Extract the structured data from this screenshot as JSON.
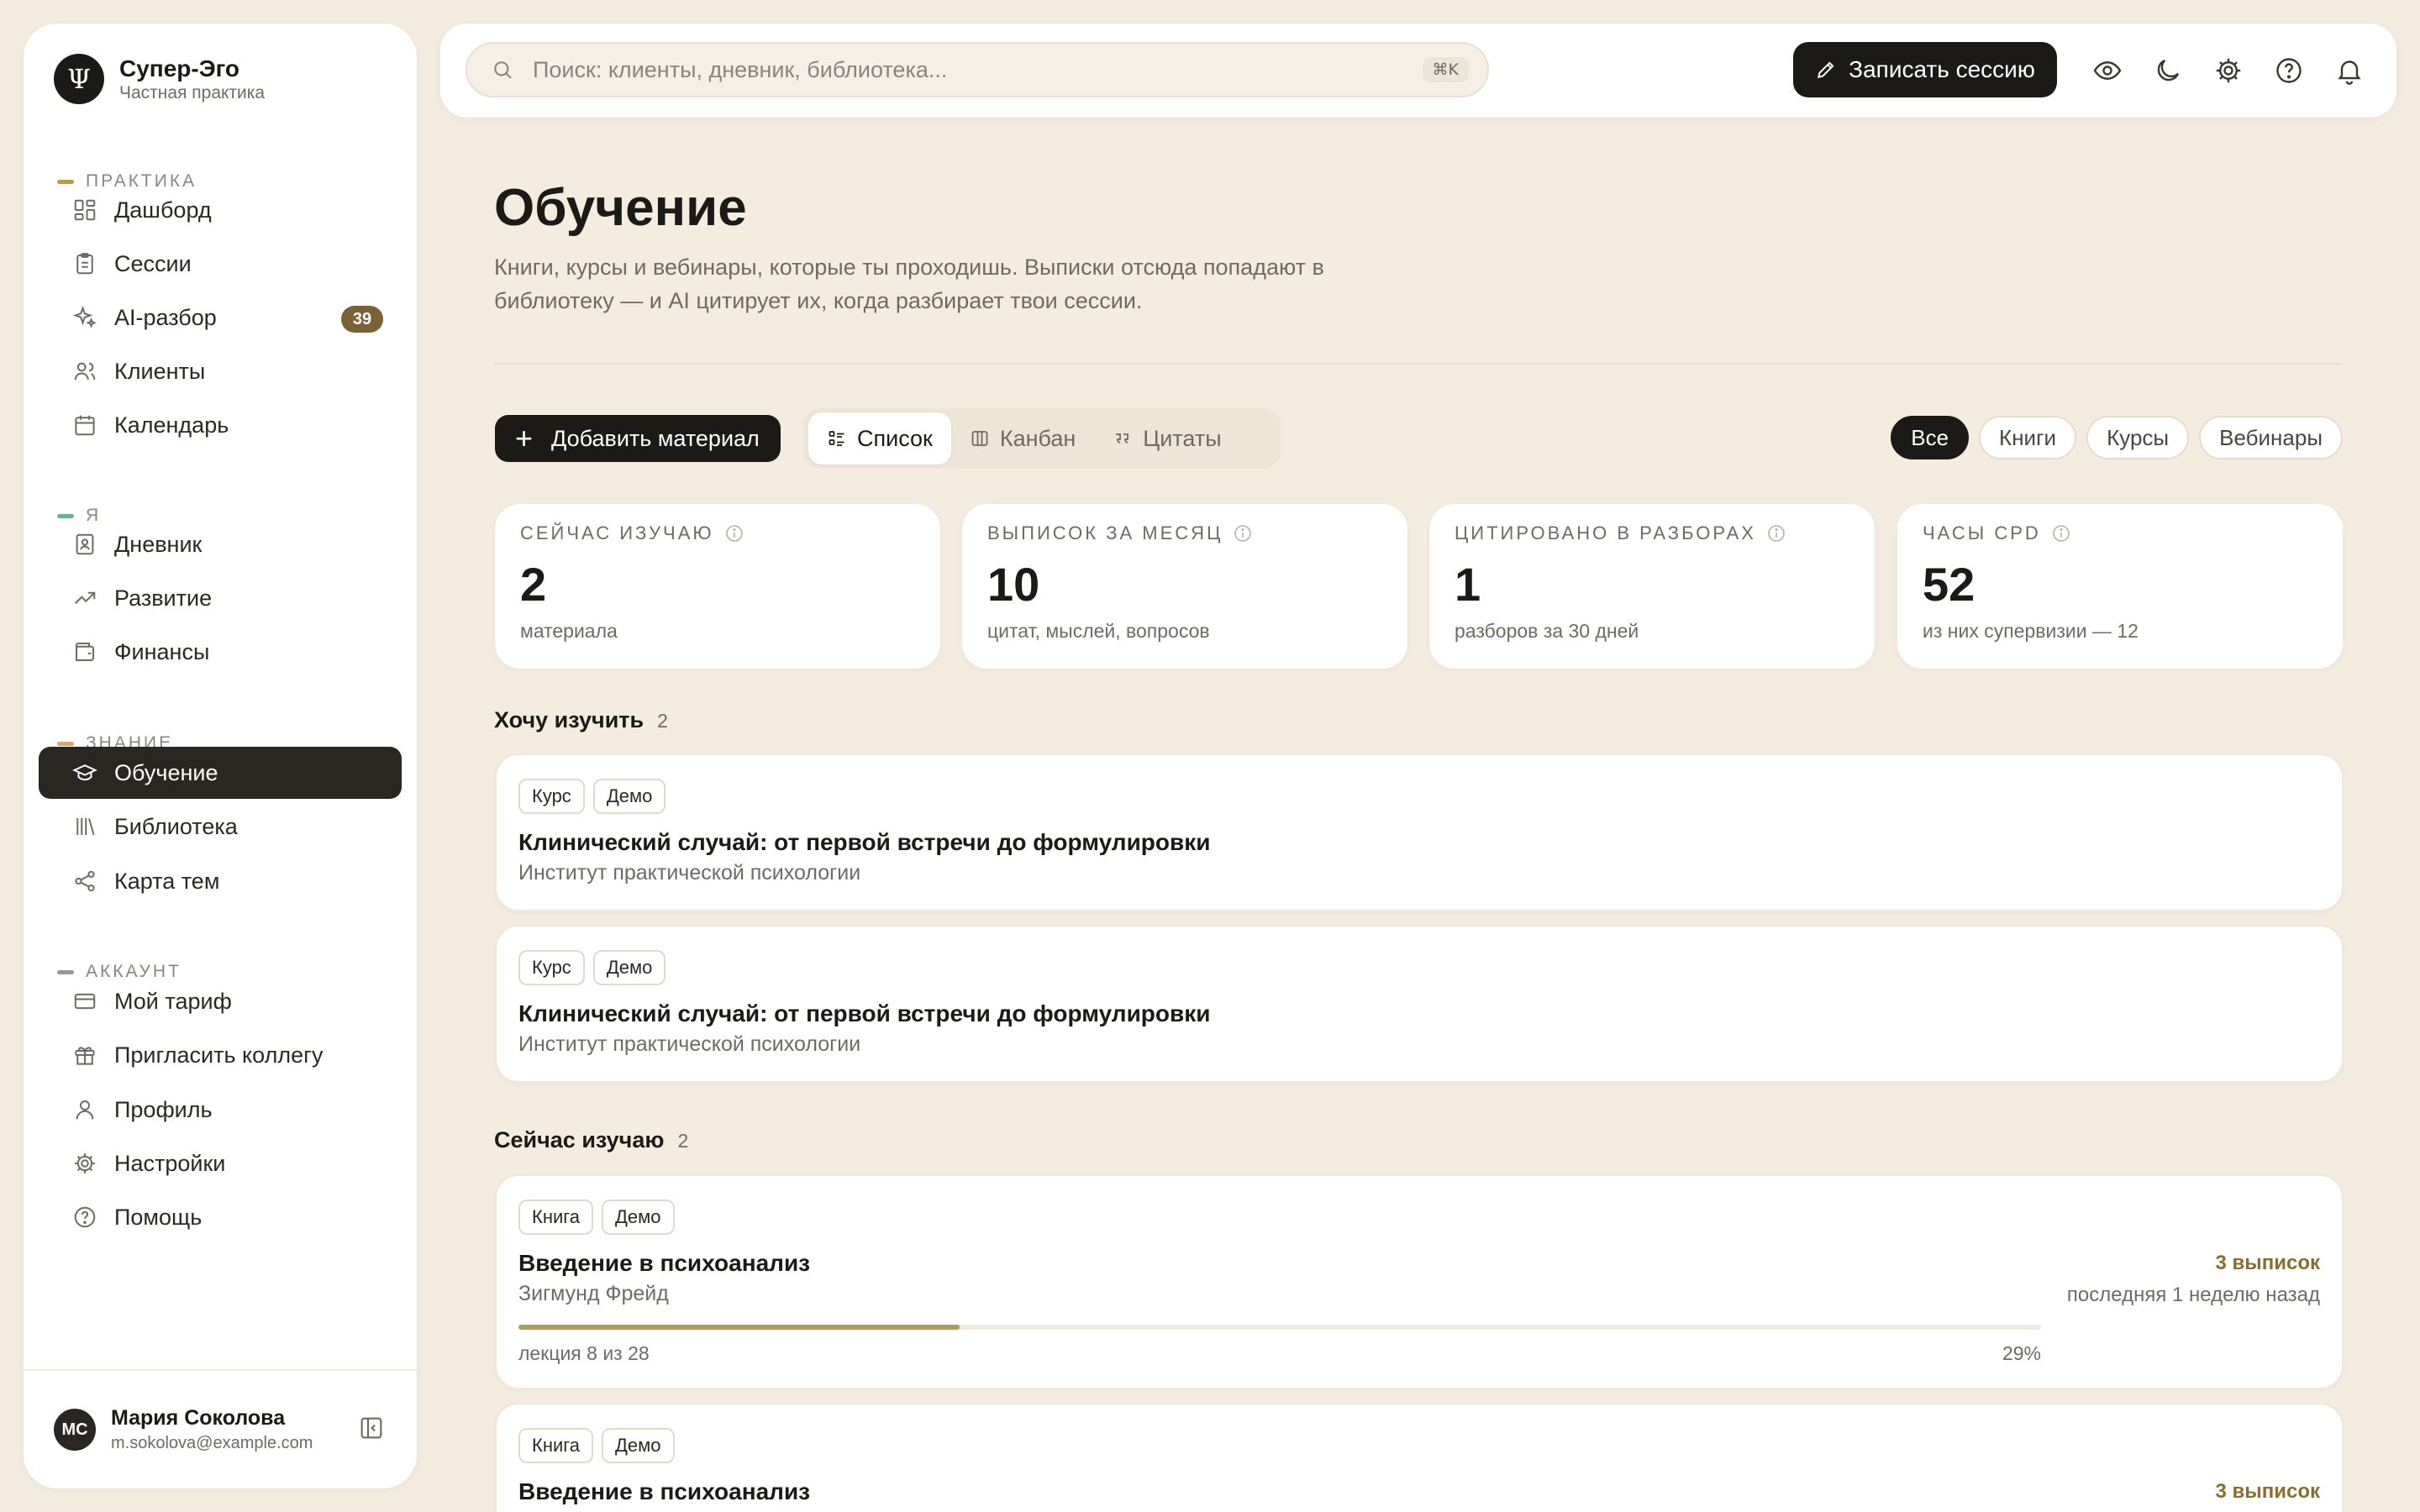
{
  "brand": {
    "name": "Супер-Эго",
    "subtitle": "Частная практика",
    "logo_glyph": "Ψ"
  },
  "sidebar": {
    "sections": [
      {
        "label": "ПРАКТИКА",
        "color": "#b59a4a"
      },
      {
        "label": "Я",
        "color": "#6fb08a"
      },
      {
        "label": "ЗНАНИЕ",
        "color": "#e2a35a"
      },
      {
        "label": "АККАУНТ",
        "color": "#9c978f"
      }
    ],
    "items": [
      {
        "label": "Дашборд",
        "icon": "dashboard-icon"
      },
      {
        "label": "Сессии",
        "icon": "clipboard-icon"
      },
      {
        "label": "AI-разбор",
        "icon": "sparkles-icon",
        "badge": "39"
      },
      {
        "label": "Клиенты",
        "icon": "users-icon"
      },
      {
        "label": "Календарь",
        "icon": "calendar-icon"
      },
      {
        "label": "Дневник",
        "icon": "journal-icon"
      },
      {
        "label": "Развитие",
        "icon": "trending-icon"
      },
      {
        "label": "Финансы",
        "icon": "wallet-icon"
      },
      {
        "label": "Обучение",
        "icon": "graduation-icon",
        "active": true
      },
      {
        "label": "Библиотека",
        "icon": "library-icon"
      },
      {
        "label": "Карта тем",
        "icon": "share-icon"
      },
      {
        "label": "Мой тариф",
        "icon": "credit-card-icon"
      },
      {
        "label": "Пригласить коллегу",
        "icon": "gift-icon"
      },
      {
        "label": "Профиль",
        "icon": "user-icon"
      },
      {
        "label": "Настройки",
        "icon": "gear-icon"
      },
      {
        "label": "Помощь",
        "icon": "help-icon"
      }
    ]
  },
  "user": {
    "initials": "МС",
    "name": "Мария Соколова",
    "email": "m.sokolova@example.com"
  },
  "topbar": {
    "search_placeholder": "Поиск: клиенты, дневник, библиотека...",
    "shortcut": "⌘K",
    "record_label": "Записать сессию"
  },
  "page": {
    "title": "Обучение",
    "description": "Книги, курсы и вебинары, которые ты проходишь. Выписки отсюда попадают в библиотеку — и AI цитирует их, когда разбирает твои сессии."
  },
  "toolbar": {
    "add_label": "Добавить материал",
    "views": [
      "Список",
      "Канбан",
      "Цитаты"
    ],
    "active_view": "Список",
    "filters": [
      "Все",
      "Книги",
      "Курсы",
      "Вебинары"
    ],
    "active_filter": "Все"
  },
  "stats": [
    {
      "label": "СЕЙЧАС ИЗУЧАЮ",
      "value": "2",
      "sub": "материала"
    },
    {
      "label": "ВЫПИСОК ЗА МЕСЯЦ",
      "value": "10",
      "sub": "цитат, мыслей, вопросов"
    },
    {
      "label": "ЦИТИРОВАНО В РАЗБОРАХ",
      "value": "1",
      "sub": "разборов за 30 дней"
    },
    {
      "label": "ЧАСЫ CPD",
      "value": "52",
      "sub": "из них супервизии — 12"
    }
  ],
  "groups": [
    {
      "title": "Хочу изучить",
      "count": "2",
      "items": [
        {
          "tags": [
            "Курс",
            "Демо"
          ],
          "title": "Клинический случай: от первой встречи до формулировки",
          "author": "Институт практической психологии"
        },
        {
          "tags": [
            "Курс",
            "Демо"
          ],
          "title": "Клинический случай: от первой встречи до формулировки",
          "author": "Институт практической психологии"
        }
      ]
    },
    {
      "title": "Сейчас изучаю",
      "count": "2",
      "items": [
        {
          "tags": [
            "Книга",
            "Демо"
          ],
          "title": "Введение в психоанализ",
          "author": "Зигмунд Фрейд",
          "notes": "3 выписок",
          "last": "последняя 1 неделю назад",
          "progress_text": "лекция 8 из 28",
          "progress_pct": "29%",
          "progress": 0.29
        },
        {
          "tags": [
            "Книга",
            "Демо"
          ],
          "title": "Введение в психоанализ",
          "notes": "3 выписок"
        }
      ]
    }
  ]
}
